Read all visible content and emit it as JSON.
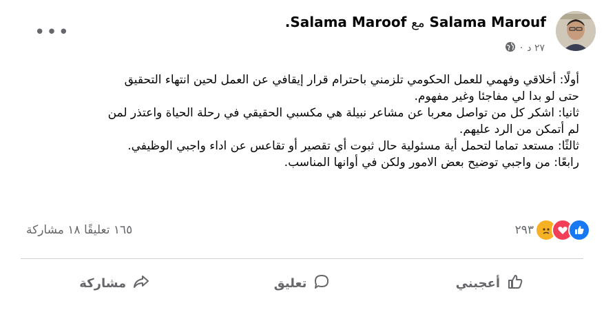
{
  "post": {
    "author": "Salama Marouf",
    "with_word": "مع",
    "tagged": "Salama Maroof",
    "trailing": ".",
    "time": "٢٧ د",
    "sep": "·",
    "lines": [
      "أولًا: أخلاقي وفهمي للعمل الحكومي تلزمني باحترام قرار إيقافي عن العمل لحين انتهاء التحقيق",
      "حتى لو بدا لي مفاجئا وغير مفهوم.",
      "ثانيا: اشكر كل من تواصل معربا عن مشاعر نبيلة هي مكسبي الحقيقي في رحلة الحياة واعتذر لمن",
      "لم أتمكن من الرد عليهم.",
      "ثالثًا: مستعد تماما لتحمل أية مسئولية حال ثبوت أي تقصير أو تقاعس عن اداء واجبي الوظيفي.",
      "رابعًا: من واجبي توضيح بعض الامور ولكن في أوانها المناسب."
    ]
  },
  "reactions": {
    "count": "٢٩٣",
    "types": [
      "like-icon",
      "love-icon",
      "sad-icon"
    ],
    "colors": {
      "like": "#1877f2",
      "love": "#f33e58",
      "sad": "#f7b125"
    }
  },
  "counts": {
    "comments": "١٦٥ تعليقًا",
    "shares": "١٨ مشاركة"
  },
  "actions": {
    "like": "أعجبني",
    "comment": "تعليق",
    "share": "مشاركة"
  }
}
